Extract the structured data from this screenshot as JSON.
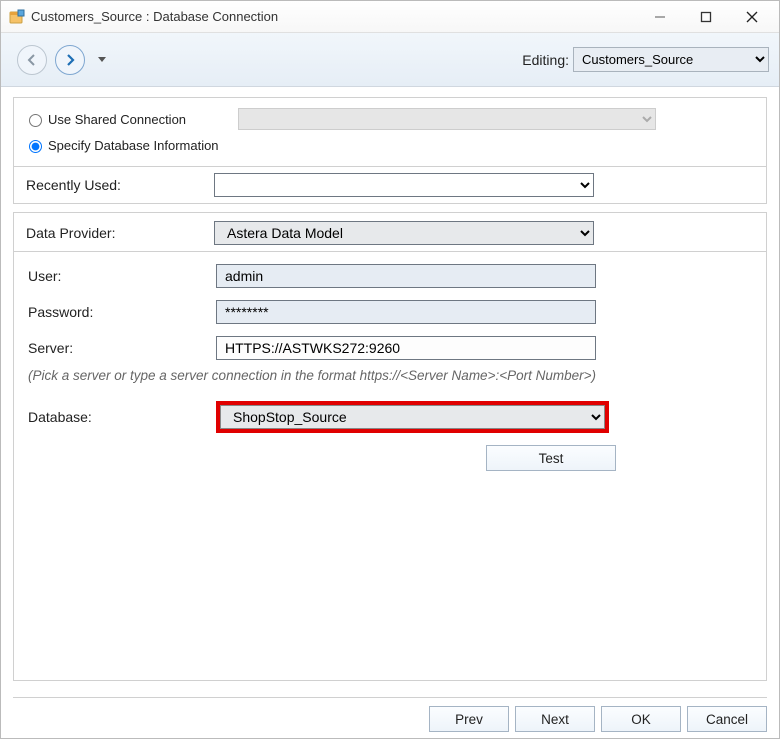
{
  "window": {
    "title": "Customers_Source : Database Connection"
  },
  "nav": {
    "editing_label": "Editing:",
    "editing_value": "Customers_Source"
  },
  "conn_mode": {
    "use_shared_label": "Use Shared Connection",
    "use_shared_selected": false,
    "shared_select_value": "",
    "specify_label": "Specify Database Information",
    "specify_selected": true
  },
  "recently_used": {
    "label": "Recently Used:",
    "value": ""
  },
  "provider": {
    "label": "Data Provider:",
    "value": "Astera Data Model"
  },
  "user": {
    "label": "User:",
    "value": "admin"
  },
  "password": {
    "label": "Password:",
    "value": "********"
  },
  "server": {
    "label": "Server:",
    "value": "HTTPS://ASTWKS272:9260",
    "hint": "(Pick a server or type a server connection in the format  https://<Server Name>:<Port Number>)"
  },
  "database": {
    "label": "Database:",
    "value": "ShopStop_Source"
  },
  "buttons": {
    "test": "Test",
    "prev": "Prev",
    "next": "Next",
    "ok": "OK",
    "cancel": "Cancel"
  }
}
